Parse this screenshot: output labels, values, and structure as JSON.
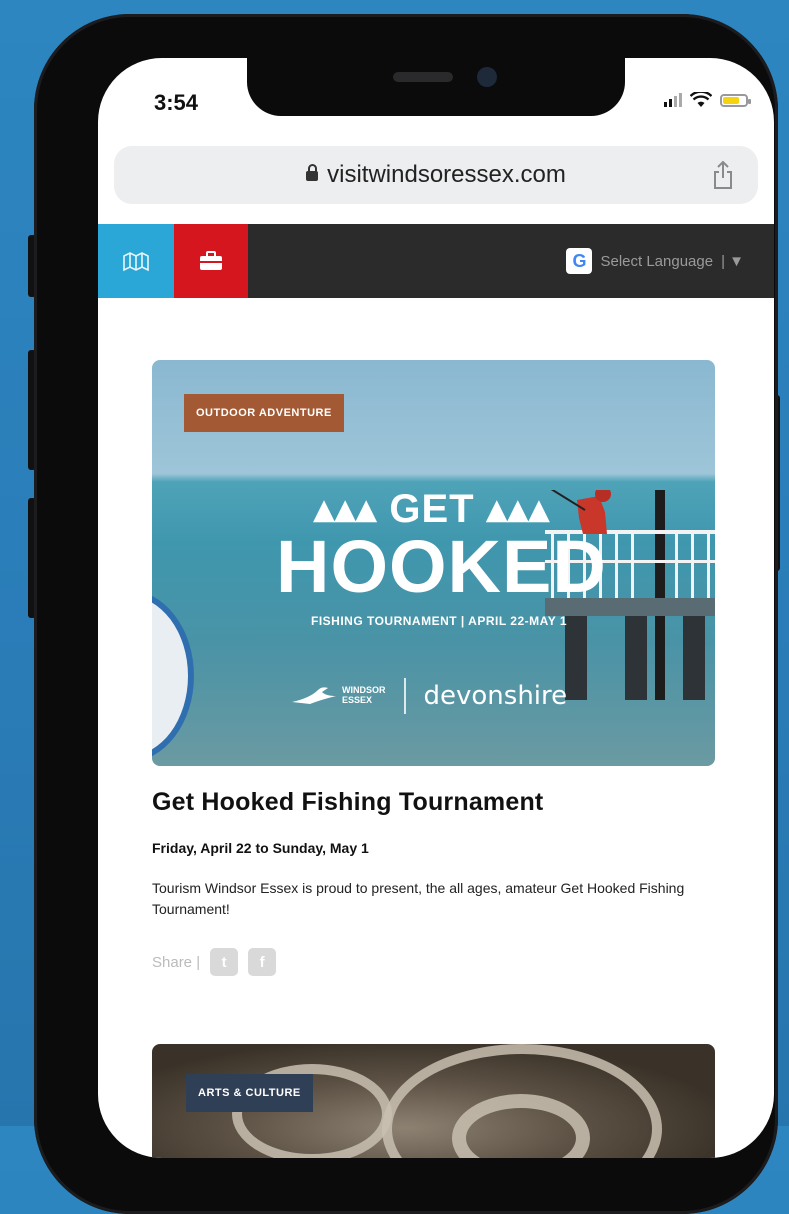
{
  "status_bar": {
    "time": "3:54"
  },
  "browser": {
    "url": "visitwindsoressex.com"
  },
  "nav": {
    "language_label": "Select Language",
    "language_sep": "| ▼",
    "google_glyph": "G"
  },
  "feature_card": {
    "category": "OUTDOOR ADVENTURE",
    "poster": {
      "get": "GET",
      "hooked": "HOOKED",
      "subtitle": "FISHING TOURNAMENT  |  APRIL 22-MAY 1",
      "logo_line1": "WINDSOR",
      "logo_line2": "ESSEX",
      "partner": "devonshire"
    },
    "title": "Get Hooked Fishing Tournament",
    "dates": "Friday, April 22 to Sunday, May 1",
    "description": "Tourism Windsor Essex is proud to present, the all ages, amateur Get Hooked Fishing Tournament!",
    "share_label": "Share  |",
    "twitter_glyph": "t",
    "facebook_glyph": "f"
  },
  "second_card": {
    "category": "ARTS & CULTURE"
  },
  "colors": {
    "background": "#2a7db8",
    "nav_dark": "#2b2b2b",
    "map_blue": "#2aa6d7",
    "case_red": "#d6161f",
    "outdoor_pill": "#a35a34",
    "arts_pill": "#2f3f55"
  },
  "icons": [
    "map-icon",
    "briefcase-icon",
    "lock-icon",
    "share-icon",
    "wifi-icon",
    "battery-icon",
    "signal-icon",
    "google-icon",
    "twitter-icon",
    "facebook-icon"
  ]
}
